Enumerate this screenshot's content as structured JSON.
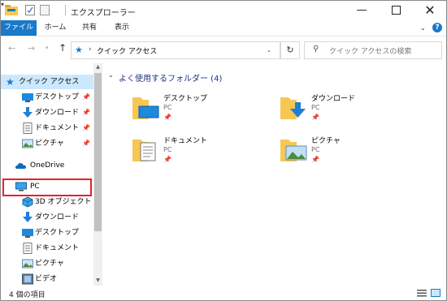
{
  "window": {
    "title": "エクスプローラー",
    "min_glyph": "—",
    "close_glyph": "✕"
  },
  "ribbon": {
    "tabs": [
      "ファイル",
      "ホーム",
      "共有",
      "表示"
    ],
    "help_glyph": "?"
  },
  "address": {
    "back_glyph": "←",
    "forward_glyph": "→",
    "up_glyph": "↑",
    "separator": "›",
    "path": "クイック アクセス",
    "refresh_glyph": "↻",
    "search_placeholder": "クイック アクセスの検索"
  },
  "navpane": {
    "quick_access": "クイック アクセス",
    "pinned": [
      {
        "label": "デスクトップ",
        "icon": "desktop-icon"
      },
      {
        "label": "ダウンロード",
        "icon": "download-icon"
      },
      {
        "label": "ドキュメント",
        "icon": "document-icon"
      },
      {
        "label": "ピクチャ",
        "icon": "picture-icon"
      }
    ],
    "onedrive": "OneDrive",
    "pc": "PC",
    "pc_children": [
      {
        "label": "3D オブジェクト",
        "icon": "3d-objects-icon"
      },
      {
        "label": "ダウンロード",
        "icon": "download-icon"
      },
      {
        "label": "デスクトップ",
        "icon": "desktop-icon"
      },
      {
        "label": "ドキュメント",
        "icon": "document-icon"
      },
      {
        "label": "ピクチャ",
        "icon": "picture-icon"
      },
      {
        "label": "ビデオ",
        "icon": "video-icon"
      }
    ]
  },
  "content": {
    "group_title": "よく使用するフォルダー (4)",
    "tiles": [
      {
        "name": "デスクトップ",
        "sub": "PC",
        "icon": "desktop-folder-icon"
      },
      {
        "name": "ダウンロード",
        "sub": "PC",
        "icon": "download-folder-icon"
      },
      {
        "name": "ドキュメント",
        "sub": "PC",
        "icon": "documents-folder-icon"
      },
      {
        "name": "ピクチャ",
        "sub": "PC",
        "icon": "pictures-folder-icon"
      }
    ]
  },
  "status": {
    "item_count": "4 個の項目"
  },
  "colors": {
    "accent": "#1979ca",
    "selection": "#cce8ff",
    "highlight_box": "#e8202a",
    "folder": "#f7c754"
  }
}
